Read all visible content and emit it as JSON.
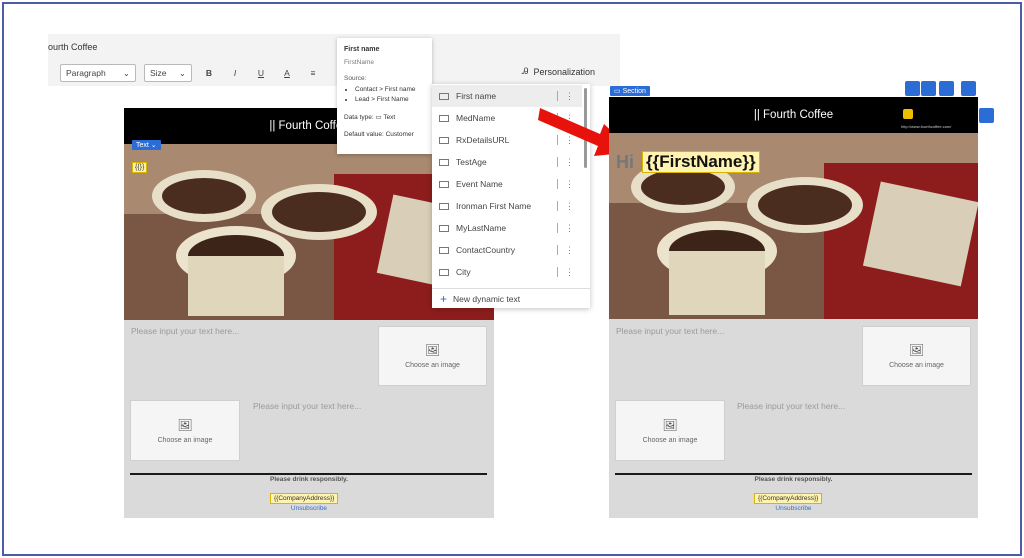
{
  "toolbar": {
    "title": "ourth Coffee",
    "paragraph": "Paragraph",
    "size": "Size",
    "bold": "B",
    "italic": "I",
    "underline": "U",
    "font_color": "A",
    "personalization": "Personalization"
  },
  "tooltip": {
    "title": "First name",
    "field": "FirstName",
    "source_label": "Source:",
    "sources": [
      "Contact > First name",
      "Lead > First Name"
    ],
    "data_type": "Data type:",
    "data_type_value": "Text",
    "default_value": "Default value:",
    "default_value_value": "Customer"
  },
  "dynamic_list": {
    "items": [
      "First name",
      "MedName",
      "RxDetailsURL",
      "TestAge",
      "Event Name",
      "Ironman First Name",
      "MyLastName",
      "ContactCountry",
      "City"
    ],
    "new_label": "New dynamic text"
  },
  "left_email": {
    "text_tag": "Text",
    "token": "{{}}",
    "header": "|| Fourth Coffee",
    "input_placeholder": "Please input your text here...",
    "choose_image": "Choose an image",
    "drink": "Please drink responsibly.",
    "company_address": "{{CompanyAddress}}",
    "unsubscribe": "Unsubscribe"
  },
  "right_email": {
    "section_tag": "Section",
    "header": "|| Fourth Coffee",
    "hi": "Hi",
    "token": "{{FirstName}}",
    "url": "http://www.fourthcoffee.com/",
    "input_placeholder": "Please input your text here...",
    "choose_image": "Choose an image",
    "drink": "Please drink responsibly.",
    "company_address": "{{CompanyAddress}}",
    "unsubscribe": "Unsubscribe"
  },
  "colors": {
    "border": "#4a5ea8",
    "accent": "#2b6cd6",
    "arrow": "#e8120c",
    "token_bg": "#fff3b0"
  }
}
